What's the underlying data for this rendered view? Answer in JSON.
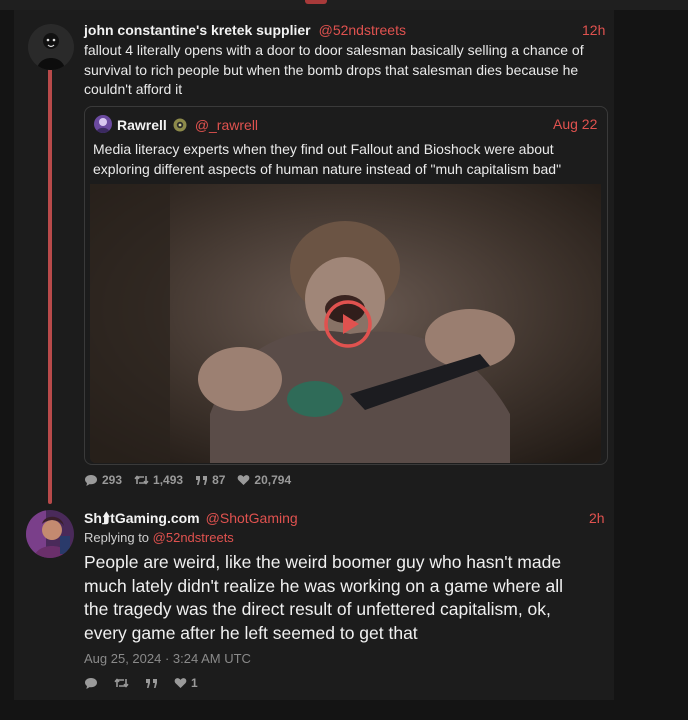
{
  "colors": {
    "accent": "#e0524f",
    "thread_line": "#b84a4a",
    "panel_bg": "#1c1c1c",
    "page_bg": "#141414",
    "muted": "#9a9a9a"
  },
  "post1": {
    "display_name": "john constantine's kretek supplier",
    "handle": "@52ndstreets",
    "time": "12h",
    "text": "fallout 4 literally opens with a door to door salesman basically selling a chance of survival to rich people but when the bomb drops that salesman dies because he couldn't afford it",
    "quote": {
      "display_name": "Rawrell",
      "badge_icon": "verified-badge-icon",
      "handle": "@_rawrell",
      "time": "Aug 22",
      "text": "Media literacy experts when they find out Fallout and Bioshock were about exploring different aspects of human nature instead of \"muh capitalism bad\"",
      "media": {
        "type": "video",
        "play_icon": "play-icon"
      }
    },
    "stats": {
      "replies": "293",
      "reposts": "1,493",
      "quotes": "87",
      "likes": "20,794"
    }
  },
  "post2": {
    "display_name": "Sh⮭tGaming.com",
    "handle": "@ShotGaming",
    "time": "2h",
    "replying_prefix": "Replying to",
    "replying_handle": "@52ndstreets",
    "text": "People are weird, like the weird boomer guy who hasn't made much lately didn't realize he was working on a game where all the tragedy was the direct result of unfettered capitalism, ok, every game after he left seemed to get that",
    "date": "Aug 25, 2024 · 3:24 AM UTC",
    "stats": {
      "replies": "",
      "reposts": "",
      "quotes": "",
      "likes": "1"
    }
  }
}
